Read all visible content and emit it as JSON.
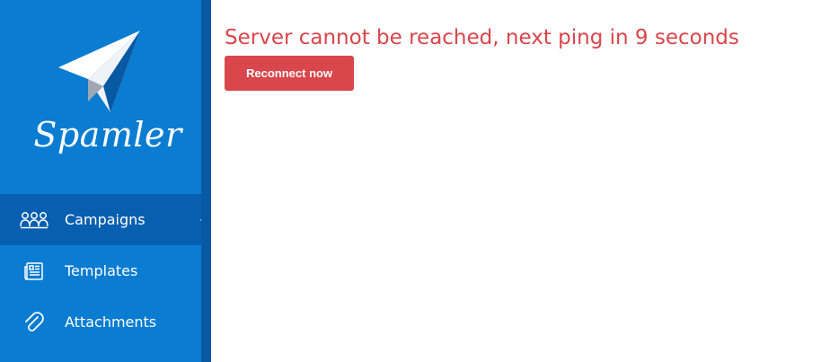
{
  "brand": {
    "name": "Spamler",
    "logo_icon": "paper-plane-icon"
  },
  "sidebar": {
    "items": [
      {
        "label": "Campaigns",
        "icon": "people-icon",
        "active": true
      },
      {
        "label": "Templates",
        "icon": "newspaper-icon",
        "active": false
      },
      {
        "label": "Attachments",
        "icon": "paperclip-icon",
        "active": false
      }
    ]
  },
  "main": {
    "status_message": "Server cannot be reached, next ping in 9 seconds",
    "reconnect_label": "Reconnect now"
  },
  "colors": {
    "sidebar": "#0a7cd1",
    "sidebar_active": "#075fb0",
    "sidebar_edge": "#0759a4",
    "error": "#d9464b"
  }
}
